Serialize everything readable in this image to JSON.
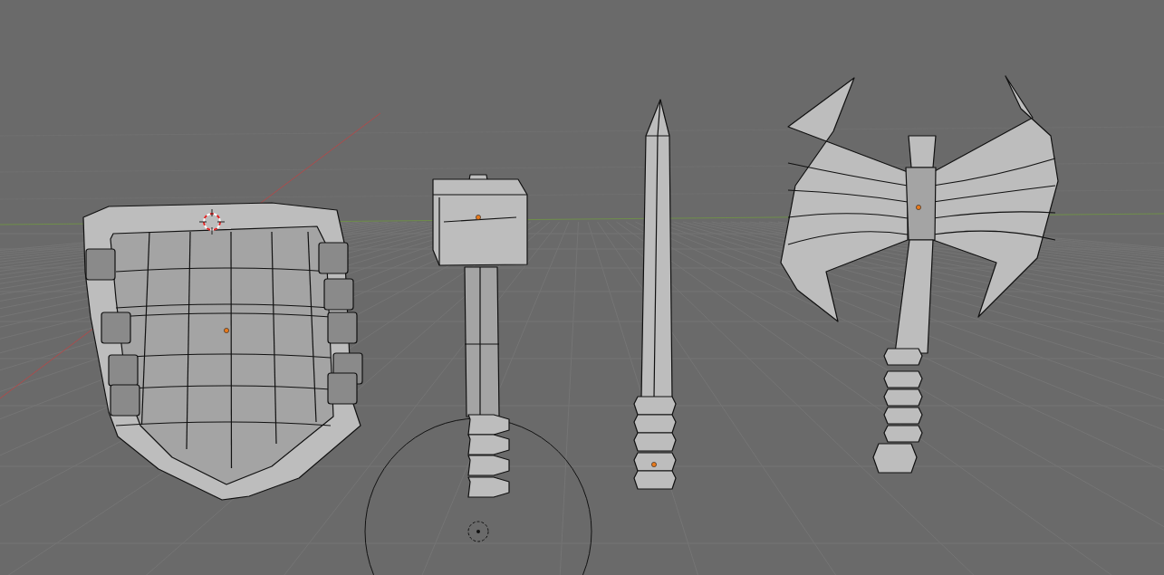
{
  "viewport": {
    "objects": [
      {
        "kind": "shield"
      },
      {
        "kind": "hammer"
      },
      {
        "kind": "sword"
      },
      {
        "kind": "axe"
      },
      {
        "kind": "light"
      },
      {
        "kind": "cursor"
      }
    ]
  }
}
